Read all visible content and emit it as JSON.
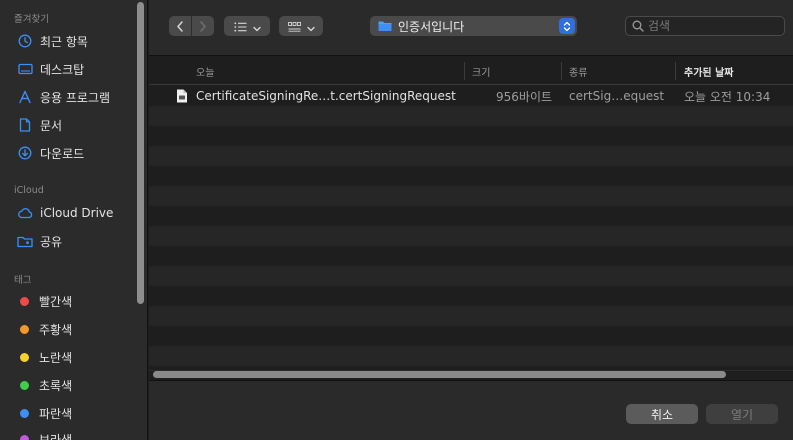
{
  "sidebar": {
    "favorites_label": "즐겨찾기",
    "favorites": [
      {
        "label": "최근 항목",
        "icon": "clock-icon"
      },
      {
        "label": "데스크탑",
        "icon": "desktop-icon"
      },
      {
        "label": "응용 프로그램",
        "icon": "applications-icon"
      },
      {
        "label": "문서",
        "icon": "document-icon"
      },
      {
        "label": "다운로드",
        "icon": "download-icon"
      }
    ],
    "icloud_label": "iCloud",
    "icloud": [
      {
        "label": "iCloud Drive",
        "icon": "cloud-icon"
      },
      {
        "label": "공유",
        "icon": "shared-folder-icon"
      }
    ],
    "tags_label": "태그",
    "tags": [
      {
        "label": "빨간색",
        "color": "#f04b4b"
      },
      {
        "label": "주황색",
        "color": "#f5962a"
      },
      {
        "label": "노란색",
        "color": "#f8d02b"
      },
      {
        "label": "초록색",
        "color": "#3fcd4a"
      },
      {
        "label": "파란색",
        "color": "#3b8ff6"
      },
      {
        "label": "보라색",
        "color": "#c05ad8"
      }
    ]
  },
  "toolbar": {
    "back_icon": "chevron-left-icon",
    "forward_icon": "chevron-right-icon",
    "list_view_icon": "list-view-icon",
    "grid_view_icon": "grid-view-icon",
    "location": "인증서입니다",
    "search_placeholder": "검색",
    "accent": "#2f6fe0"
  },
  "columns": {
    "name": "오늘",
    "size": "크기",
    "kind": "종류",
    "date_added": "추가된 날짜"
  },
  "files": [
    {
      "name": "CertificateSigningRe…t.certSigningRequest",
      "size": "956바이트",
      "kind": "certSig…equest",
      "date_added": "오늘 오전 10:34",
      "icon": "certificate-file-icon"
    }
  ],
  "buttons": {
    "cancel": "취소",
    "open": "열기"
  }
}
